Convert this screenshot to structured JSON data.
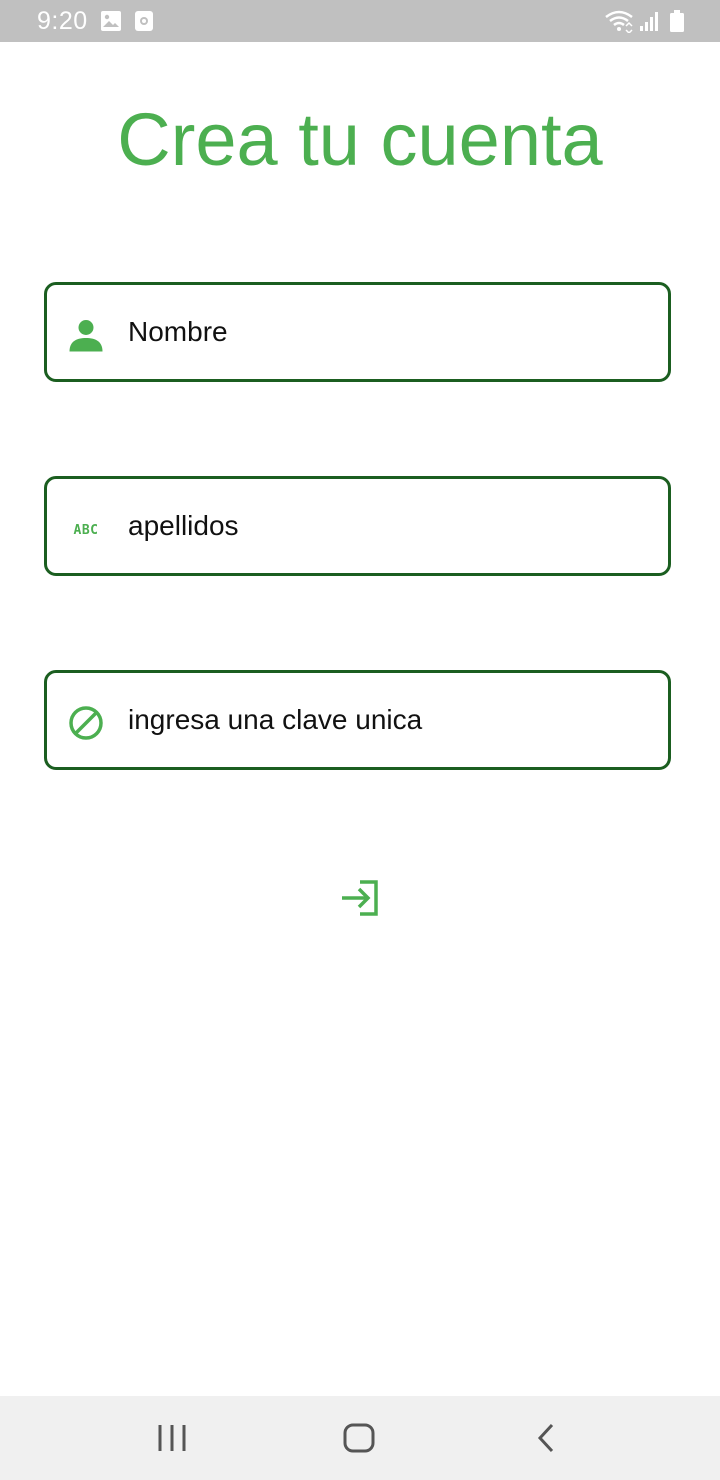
{
  "status_bar": {
    "time": "9:20",
    "icons": [
      "gallery-icon",
      "notification-icon",
      "wifi-icon",
      "signal-icon",
      "battery-icon"
    ]
  },
  "page": {
    "title": "Crea tu cuenta"
  },
  "form": {
    "fields": [
      {
        "icon": "person-icon",
        "placeholder": "Nombre"
      },
      {
        "icon": "abc-icon",
        "placeholder": "apellidos"
      },
      {
        "icon": "block-icon",
        "placeholder": "ingresa una clave unica"
      }
    ],
    "submit_icon": "login-icon"
  },
  "nav_bar": {
    "buttons": [
      "recents-icon",
      "home-icon",
      "back-icon"
    ]
  },
  "colors": {
    "accent": "#4caf50",
    "field_border": "#1b5e20",
    "status_bar_bg": "#c0c0c0",
    "nav_bar_bg": "#f0f0f0"
  }
}
